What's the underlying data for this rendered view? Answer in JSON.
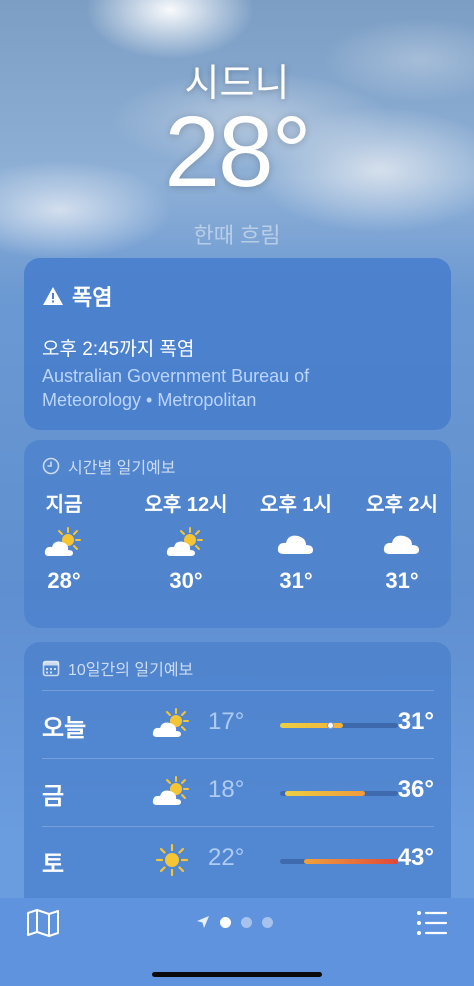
{
  "header": {
    "city": "시드니",
    "temperature": "28°",
    "condition": "한때 흐림"
  },
  "alert": {
    "title": "폭염",
    "message": "오후 2:45까지 폭염",
    "source_line1": "Australian Government Bureau of",
    "source_line2": "Meteorology • Metropolitan",
    "icon": "warning-triangle-icon"
  },
  "hourly": {
    "title": "시간별 일기예보",
    "icon": "clock-icon",
    "items": [
      {
        "time": "지금",
        "icon": "partly-sunny-icon",
        "temp": "28°"
      },
      {
        "time": "오후 12시",
        "icon": "partly-sunny-icon",
        "temp": "30°"
      },
      {
        "time": "오후 1시",
        "icon": "cloud-icon",
        "temp": "31°"
      },
      {
        "time": "오후 2시",
        "icon": "cloud-icon",
        "temp": "31°"
      }
    ]
  },
  "daily": {
    "title": "10일간의 일기예보",
    "icon": "calendar-icon",
    "items": [
      {
        "day": "오늘",
        "icon": "partly-sunny-icon",
        "low": "17°",
        "high": "31°",
        "range_start": 0.0,
        "range_end": 0.53,
        "current": 0.42
      },
      {
        "day": "금",
        "icon": "partly-sunny-icon",
        "low": "18°",
        "high": "36°",
        "range_start": 0.04,
        "range_end": 0.72
      },
      {
        "day": "토",
        "icon": "sun-icon",
        "low": "22°",
        "high": "43°",
        "range_start": 0.2,
        "range_end": 1.0
      }
    ]
  },
  "tabbar": {
    "map_icon": "map-icon",
    "location_icon": "location-arrow-icon",
    "list_icon": "list-icon",
    "pages": 2,
    "current_page": 1
  },
  "colors": {
    "card": "#4a80cc",
    "tabbar": "#5f93de",
    "bar_cool": "#f2d24a",
    "bar_hot": "#e0483a"
  }
}
